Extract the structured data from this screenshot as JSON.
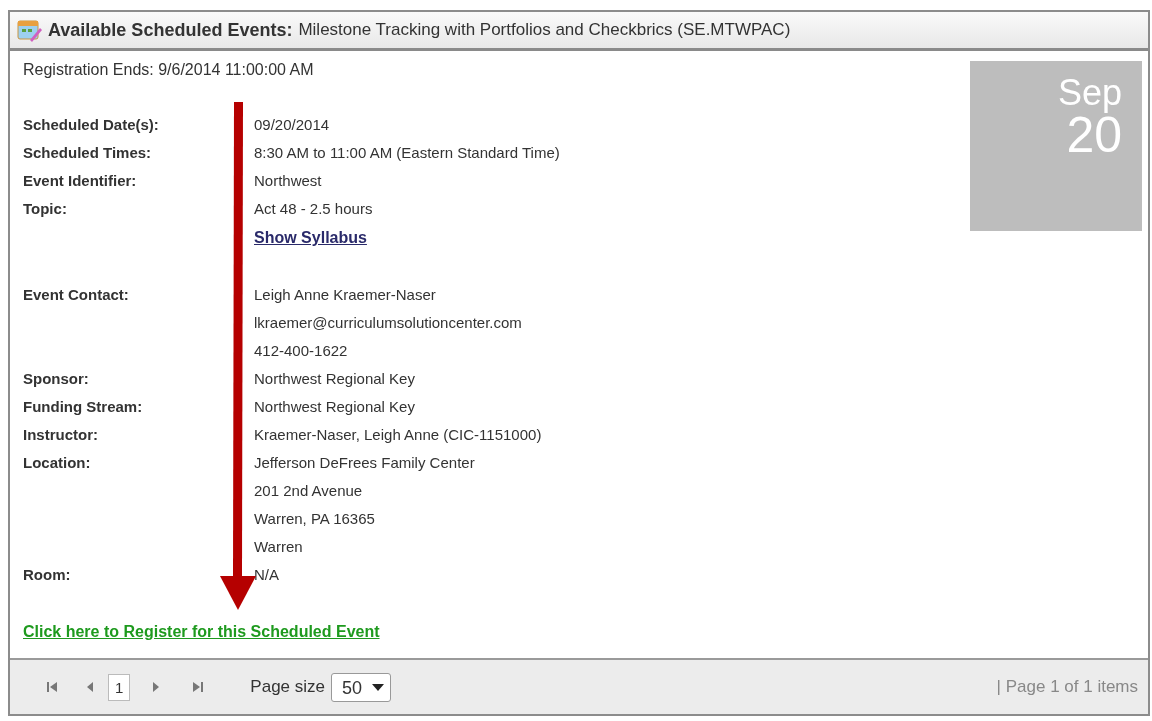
{
  "header": {
    "title": "Available Scheduled Events:",
    "subtitle": "Milestone Tracking with Portfolios and Checkbrics (SE.MTWPAC)"
  },
  "registration": "Registration Ends: 9/6/2014 11:00:00 AM",
  "date_tile": {
    "month": "Sep",
    "day": "20"
  },
  "details": [
    {
      "label": "Scheduled Date(s):",
      "values": [
        "09/20/2014"
      ]
    },
    {
      "label": "Scheduled Times:",
      "values": [
        "8:30 AM to 11:00 AM (Eastern Standard Time)"
      ]
    },
    {
      "label": "Event Identifier:",
      "values": [
        "Northwest"
      ]
    },
    {
      "label": "Topic:",
      "values": [
        "Act 48 - 2.5 hours"
      ],
      "link": "Show Syllabus"
    },
    {
      "label": "Event Contact:",
      "values": [
        "Leigh Anne Kraemer-Naser",
        "lkraemer@curriculumsolutioncenter.com",
        "412-400-1622"
      ],
      "gap": true
    },
    {
      "label": "Sponsor:",
      "values": [
        "Northwest Regional Key"
      ]
    },
    {
      "label": "Funding Stream:",
      "values": [
        "Northwest Regional Key"
      ]
    },
    {
      "label": "Instructor:",
      "values": [
        "Kraemer-Naser, Leigh Anne (CIC-1151000)"
      ]
    },
    {
      "label": "Location:",
      "values": [
        "Jefferson DeFrees Family Center",
        "201 2nd Avenue",
        "Warren, PA 16365",
        "Warren"
      ]
    },
    {
      "label": "Room:",
      "values": [
        "N/A"
      ]
    }
  ],
  "register_link": "Click here to Register for this Scheduled Event",
  "pager": {
    "page": "1",
    "page_size_label": "Page size",
    "page_size": "50",
    "summary": "| Page 1 of 1 items"
  }
}
